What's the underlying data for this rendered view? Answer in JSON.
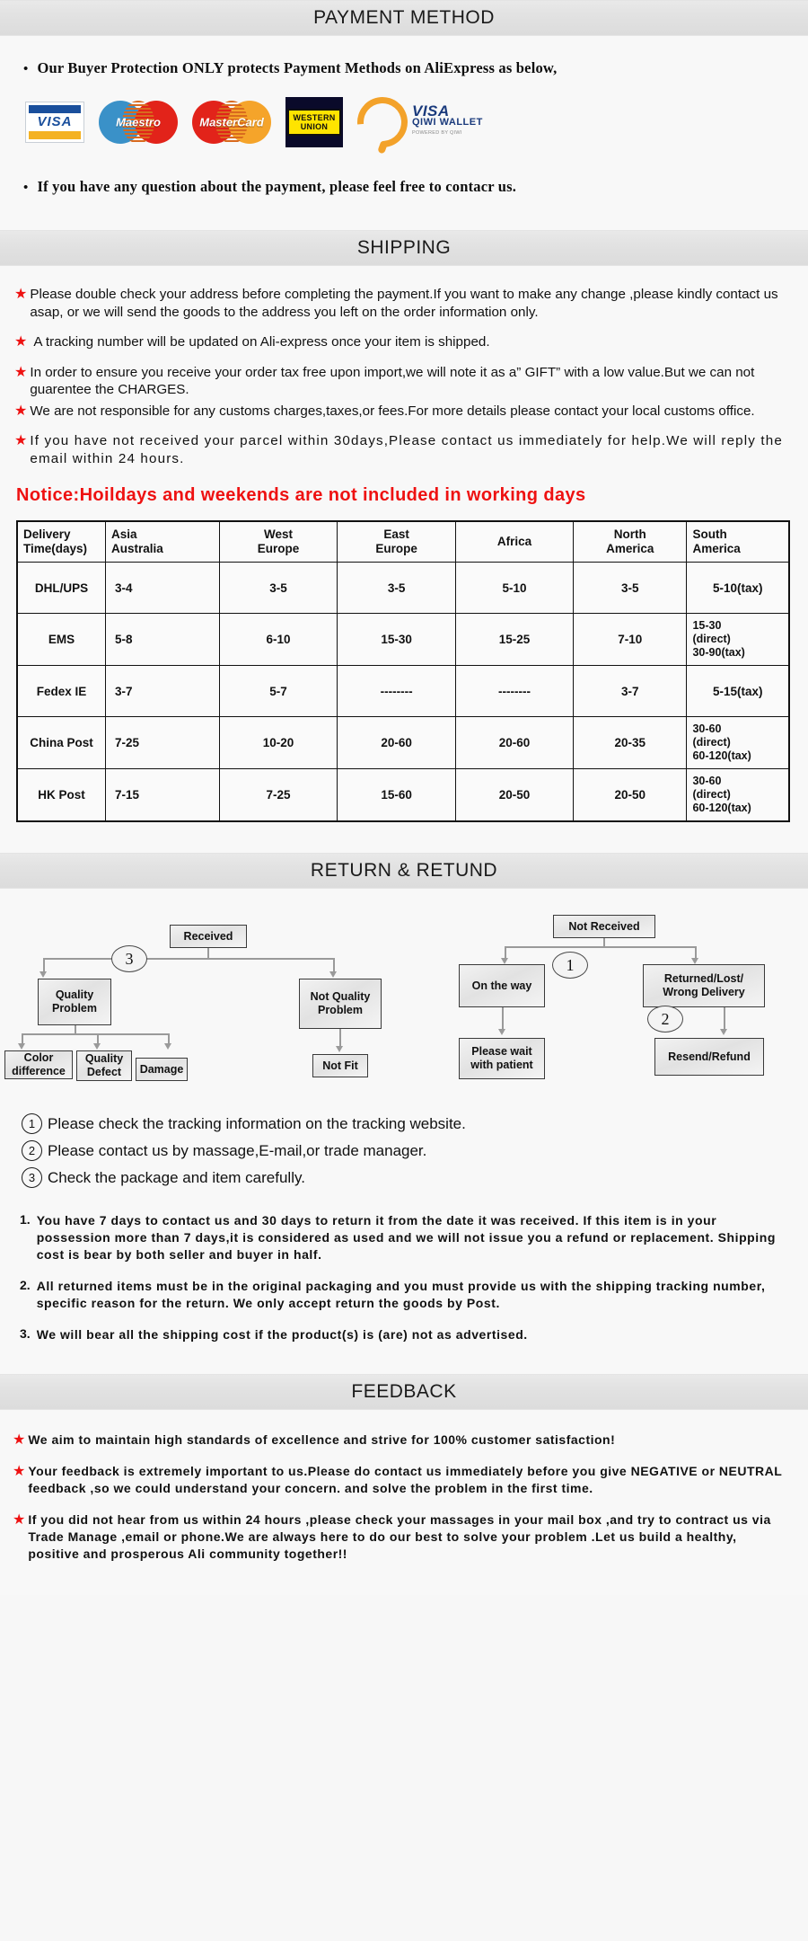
{
  "sections": {
    "payment": {
      "title": "PAYMENT METHOD",
      "line1": "Our Buyer Protection ONLY protects Payment Methods on AliExpress as below,",
      "line2": "If you have any question about the payment, please feel free to contacr us.",
      "logos": [
        {
          "name": "visa-logo",
          "text": "VISA"
        },
        {
          "name": "maestro-logo",
          "text": "Maestro"
        },
        {
          "name": "mastercard-logo",
          "text": "MasterCard"
        },
        {
          "name": "western-union-logo",
          "line1": "WESTERN",
          "line2": "UNION"
        },
        {
          "name": "qiwi-wallet-logo",
          "brand": "VISA",
          "wallet": "QIWI WALLET",
          "powered": "POWERED BY QIWI"
        }
      ]
    },
    "shipping": {
      "title": "SHIPPING",
      "bullets": [
        "Please double check your address before completing the payment.If you want to make any change ,please kindly contact us asap, or we will send the goods to the address you left on the order information only.",
        "A tracking number will be updated on Ali-express once your item is shipped.",
        "In order to ensure you receive your order tax free upon import,we will note it as a” GIFT” with a low value.But we can not guarentee the CHARGES.",
        "We are not responsible for any customs charges,taxes,or fees.For more details please contact your local customs office.",
        "If you have not received your parcel within 30days,Please contact us immediately for help.We will reply the email within 24 hours."
      ],
      "notice": "Notice:Hoildays and weekends are not included in working days",
      "table": {
        "headers": [
          "Delivery Time(days)",
          "Asia Australia",
          "West Europe",
          "East Europe",
          "Africa",
          "North America",
          "South America"
        ],
        "header_lines": [
          [
            "Delivery",
            "Time(days)"
          ],
          [
            "Asia",
            "Australia"
          ],
          [
            "West",
            "Europe"
          ],
          [
            "East",
            "Europe"
          ],
          [
            "Africa"
          ],
          [
            "North",
            "America"
          ],
          [
            "South",
            "America"
          ]
        ],
        "rows": [
          {
            "method": "DHL/UPS",
            "cells": [
              "3-4",
              "3-5",
              "3-5",
              "5-10",
              "3-5",
              "5-10(tax)"
            ]
          },
          {
            "method": "EMS",
            "cells": [
              "5-8",
              "6-10",
              "15-30",
              "15-25",
              "7-10",
              "15-30 (direct) 30-90(tax)"
            ]
          },
          {
            "method": "Fedex IE",
            "cells": [
              "3-7",
              "5-7",
              "--------",
              "--------",
              "3-7",
              "5-15(tax)"
            ]
          },
          {
            "method": "China Post",
            "cells": [
              "7-25",
              "10-20",
              "20-60",
              "20-60",
              "20-35",
              "30-60 (direct) 60-120(tax)"
            ]
          },
          {
            "method": "HK Post",
            "cells": [
              "7-15",
              "7-25",
              "15-60",
              "20-50",
              "20-50",
              "30-60 (direct) 60-120(tax)"
            ]
          }
        ],
        "multiline_cells": {
          "ems_south": [
            "15-30",
            "(direct)",
            "30-90(tax)"
          ],
          "china_south": [
            "30-60",
            "(direct)",
            "60-120(tax)"
          ],
          "hk_south": [
            "30-60",
            "(direct)",
            "60-120(tax)"
          ]
        }
      }
    },
    "return": {
      "title": "RETURN & RETUND",
      "flow_left": {
        "root": "Received",
        "marker": "3",
        "branch_a": "Quality Problem",
        "branch_b": "Not Quality Problem",
        "leaves_a": [
          "Color difference",
          "Quality Defect",
          "Damage"
        ],
        "leaves_b": [
          "Not Fit"
        ]
      },
      "flow_right": {
        "root": "Not  Received",
        "marker1": "1",
        "marker2": "2",
        "branch_a": "On the way",
        "branch_b": "Returned/Lost/ Wrong Delivery",
        "leaf_a": "Please wait with patient",
        "leaf_b": "Resend/Refund"
      },
      "circled_notes": [
        {
          "num": "①",
          "text": "Please check the tracking information on the tracking website."
        },
        {
          "num": "②",
          "text": "Please contact us by  massage,E-mail,or trade manager."
        },
        {
          "num": "③",
          "text": "Check the package and item carefully."
        }
      ],
      "policies": [
        {
          "num": "1.",
          "text": "You have 7 days to contact us and 30 days to return it from the date it was received. If this item is in your possession more than 7 days,it is considered as used and we will not issue you a refund or replacement. Shipping cost is bear by both seller and buyer in half."
        },
        {
          "num": "2.",
          "text": "All returned items must be in the original packaging and you must provide us with the shipping tracking number, specific reason for the return. We only accept return the goods by Post."
        },
        {
          "num": "3.",
          "text": "We will bear all the shipping cost if the product(s) is (are) not as advertised."
        }
      ]
    },
    "feedback": {
      "title": "FEEDBACK",
      "items": [
        "We aim to maintain high standards of excellence and strive  for 100% customer satisfaction!",
        "Your feedback is extremely important to us.Please do contact us immediately before you give NEGATIVE or NEUTRAL feedback ,so  we could understand your concern. and solve the problem in the first time.",
        "If you did not hear from us within 24 hours ,please check your massages in your mail box ,and try to contract us via Trade Manage ,email or phone.We are always here to do our best to solve your problem .Let us build a healthy, positive and prosperous Ali community together!!"
      ]
    }
  },
  "colors": {
    "star_red": "#ee1111",
    "notice_red": "#ee1111",
    "bar_gray": "#e2e2e2",
    "page_bg": "#f8f8f8"
  },
  "glyphs": {
    "star": "★",
    "bullet_dot": "•"
  }
}
